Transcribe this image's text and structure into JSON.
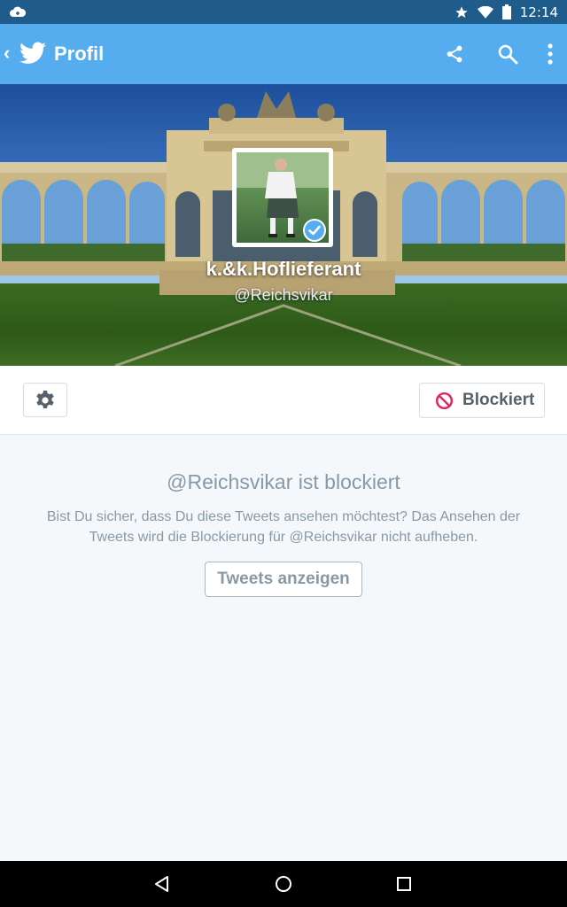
{
  "status_bar": {
    "time": "12:14",
    "icons": [
      "cloud-notification-icon",
      "star-icon",
      "wifi-icon",
      "battery-icon"
    ]
  },
  "app_bar": {
    "back_glyph": "‹",
    "title": "Profil",
    "icons": [
      "twitter-bird-icon",
      "share-icon",
      "search-icon",
      "more-vert-icon"
    ]
  },
  "profile": {
    "name": "k.&k.Hoflieferant",
    "handle": "@Reichsvikar",
    "verified": true
  },
  "actions": {
    "settings_icon": "gear-icon",
    "blocked_label": "Blockiert",
    "blocked_icon": "block-icon"
  },
  "notice": {
    "title": "@Reichsvikar ist blockiert",
    "text": "Bist Du sicher, dass Du diese Tweets ansehen möchtest? Das Ansehen der Tweets wird die Blockierung für @Reichsvikar nicht aufheben.",
    "button_label": "Tweets anzeigen"
  },
  "colors": {
    "app_bar": "#55acee",
    "status_bar": "#1f5c8c",
    "block_red": "#e0245e",
    "muted_text": "#8899a6"
  }
}
